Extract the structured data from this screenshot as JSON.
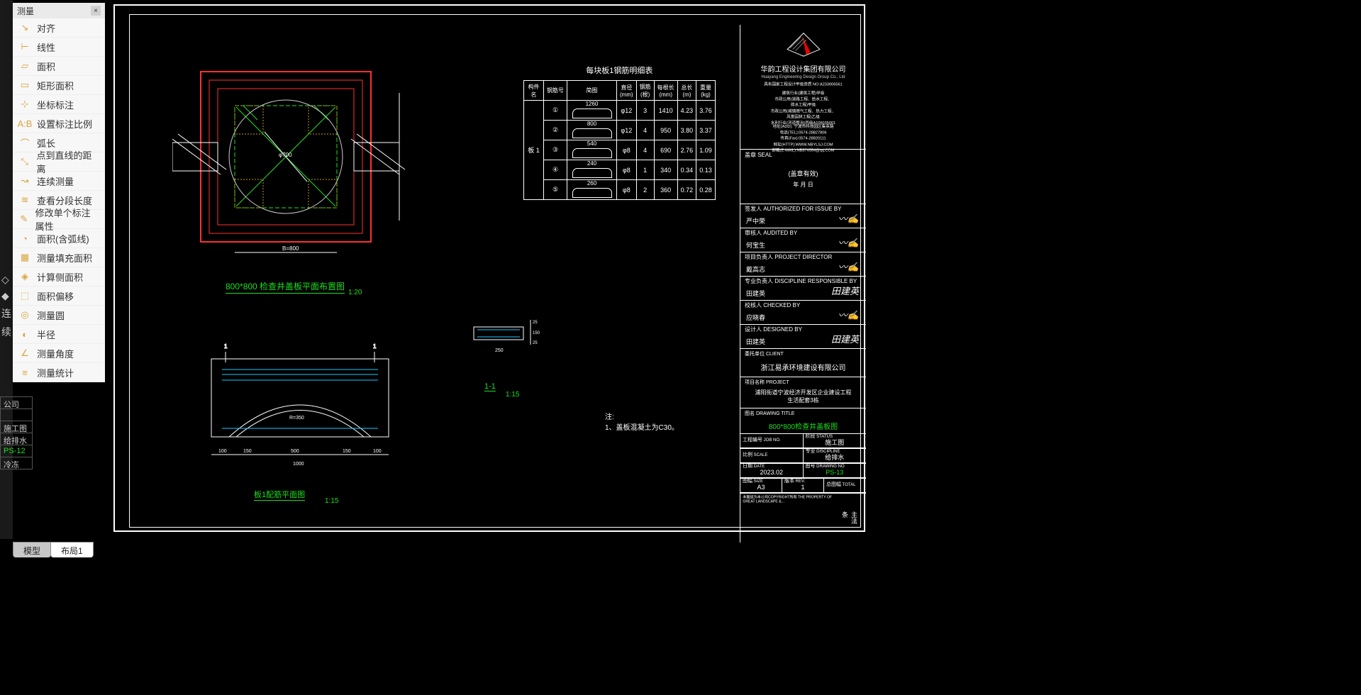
{
  "measure_panel": {
    "title": "测量",
    "items": [
      {
        "label": "对齐",
        "icon": "↘"
      },
      {
        "label": "线性",
        "icon": "⊢"
      },
      {
        "label": "面积",
        "icon": "▱"
      },
      {
        "label": "矩形面积",
        "icon": "▭"
      },
      {
        "label": "坐标标注",
        "icon": "⊹"
      },
      {
        "label": "设置标注比例",
        "icon": "A:B"
      },
      {
        "label": "弧长",
        "icon": "⌒"
      },
      {
        "label": "点到直线的距离",
        "icon": "⤡"
      },
      {
        "label": "连续测量",
        "icon": "↝"
      },
      {
        "label": "查看分段长度",
        "icon": "≋"
      },
      {
        "label": "修改单个标注属性",
        "icon": "✎"
      },
      {
        "label": "面积(含弧线)",
        "icon": "◔"
      },
      {
        "label": "测量填充面积",
        "icon": "▦"
      },
      {
        "label": "计算侧面积",
        "icon": "◈"
      },
      {
        "label": "面积偏移",
        "icon": "⬚"
      },
      {
        "label": "测量圆",
        "icon": "◎"
      },
      {
        "label": "半径",
        "icon": "◐"
      },
      {
        "label": "测量角度",
        "icon": "∠"
      },
      {
        "label": "测量统计",
        "icon": "≡"
      }
    ]
  },
  "left_info": {
    "rows": [
      "公司",
      "",
      "施工图",
      "给排水",
      "PS-12",
      "冷冻"
    ]
  },
  "plan": {
    "title": "800*800 检查井盖板平面布置图",
    "scale": "1:20"
  },
  "section": {
    "title": "板1配筋平面图",
    "scale": "1:15"
  },
  "detail": {
    "title": "1-1",
    "scale": "1:15"
  },
  "notes": {
    "heading": "注:",
    "line1": "1、盖板混凝土为C30。"
  },
  "steel_table": {
    "title": "每块板1钢筋明细表",
    "headers": [
      "构件名",
      "钢筋号",
      "简图",
      "直径 (mm)",
      "钢筋 (根)",
      "每根长 (mm)",
      "总长 (m)",
      "重量 (kg)"
    ],
    "member": "板 1",
    "rows": [
      {
        "no": "①",
        "len": "1260",
        "d": "φ12",
        "n": "3",
        "l": "1410",
        "tl": "4.23",
        "w": "3.76"
      },
      {
        "no": "②",
        "len": "800",
        "d": "φ12",
        "n": "4",
        "l": "950",
        "tl": "3.80",
        "w": "3.37"
      },
      {
        "no": "③",
        "len": "540",
        "d": "φ8",
        "n": "4",
        "l": "690",
        "tl": "2.76",
        "w": "1.09"
      },
      {
        "no": "④",
        "len": "240",
        "d": "φ8",
        "n": "1",
        "l": "340",
        "tl": "0.34",
        "w": "0.13"
      },
      {
        "no": "⑤",
        "len": "260",
        "d": "φ8",
        "n": "2",
        "l": "360",
        "tl": "0.72",
        "w": "0.28"
      }
    ]
  },
  "title_block": {
    "company": "华韵工程设计集团有限公司",
    "company_en": "Huayang Engineering Design Group Co., Ltd",
    "cert": "具有国家工程设计甲级资质 NO:A233006561",
    "info_lines": [
      "建筑行业(建筑工程)甲级",
      "市政公用(道路工程、给水工程、",
      "排水工程)甲级",
      "市政公用(城镇燃气工程、热力工程、",
      "风景园林工程)乙级",
      "水利行业(河道整治)丙级A105035001"
    ],
    "addr": "地址(ADD): 宁波市科技园区集英路",
    "tel": "电话(TEL):0574-28827806",
    "fax": "传真(Fax):0574-28820111",
    "web": "网址(HTTP):WWW.NBYLSJ.COM",
    "mail": "邮箱(E-MAIL):NB874554@qq.COM",
    "seal": {
      "lbl": "盖章 SEAL"
    },
    "stamp": "(盖章有效)",
    "date_lbls": "年      月      日",
    "signs": [
      {
        "lbl": "签发人 AUTHORIZED FOR ISSUE BY",
        "name": "严中荣"
      },
      {
        "lbl": "审核人 AUDITED BY",
        "name": "何宝生"
      },
      {
        "lbl": "项目负责人 PROJECT DIRECTOR",
        "name": "戴高志"
      },
      {
        "lbl": "专业负责人 DISCIPLINE RESPONSIBLE BY",
        "name": "田建英",
        "sig": "田建英"
      },
      {
        "lbl": "校核人 CHECKED BY",
        "name": "应晓春"
      },
      {
        "lbl": "设计人 DESIGNED BY",
        "name": "田建英",
        "sig": "田建英"
      }
    ],
    "client": {
      "lbl": "委托单位 CLIENT",
      "val": "浙江易承环境建设有限公司"
    },
    "project": {
      "lbl": "项目名称 PROJECT",
      "line1": "浦阳街道宁波经济开发区企业建设工程",
      "line2": "生活配套3栋"
    },
    "drawing": {
      "lbl": "图名 DRAWING TITLE",
      "val": "800*800检查井盖板图"
    },
    "grid": {
      "r1": [
        {
          "l": "工程编号",
          "s": "JOB NO.",
          "v": ""
        },
        {
          "l": "阶段",
          "s": "STATUS",
          "v": "施工图"
        }
      ],
      "r2": [
        {
          "l": "比例",
          "s": "SCALE",
          "v": ""
        },
        {
          "l": "专业",
          "s": "DISCIPLINE",
          "v": "给排水"
        }
      ],
      "r3": [
        {
          "l": "日期",
          "s": "DATE",
          "v": "2023.02"
        },
        {
          "l": "图号",
          "s": "DRAWING NO",
          "v": "PS-13",
          "green": true
        }
      ],
      "r4": [
        {
          "l": "图幅",
          "s": "SIZE",
          "v": "A3"
        },
        {
          "l": "版本",
          "s": "REV.",
          "v": "1"
        },
        {
          "l": "总图幅",
          "s": "TOTAL",
          "v": ""
        }
      ]
    },
    "footer": "本图纸为本公司COPYRIGHT所有 THE PROPERTY OF GREAT LANDSCAPE &..."
  },
  "side_anno": "主法条",
  "tabs": [
    {
      "label": "模型",
      "active": false
    },
    {
      "label": "布局1",
      "active": true
    }
  ]
}
